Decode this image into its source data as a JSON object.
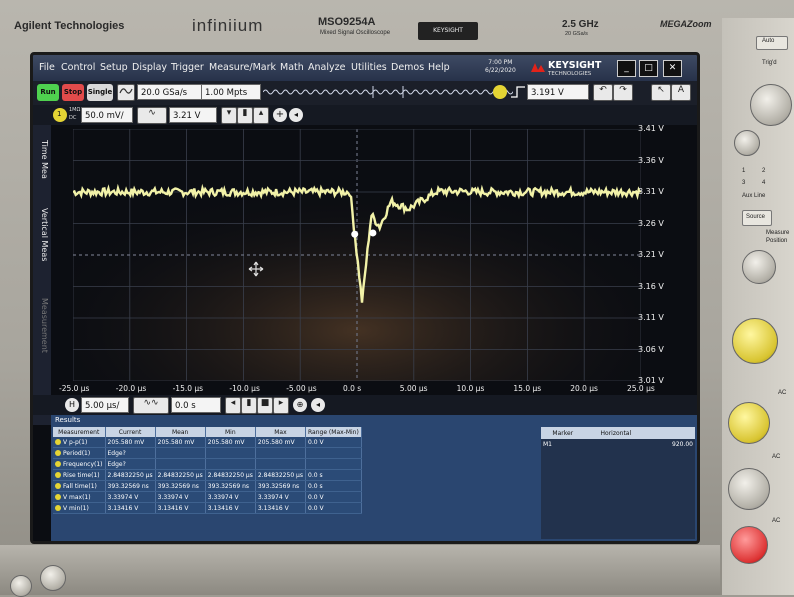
{
  "instrument": {
    "brand": "Agilent Technologies",
    "series": "infiniium",
    "model": "MSO9254A",
    "model_sub": "Mixed Signal Oscilloscope",
    "bandwidth": "2.5 GHz",
    "sample_rate_spec": "20 GSa/s",
    "mega": "MEGAZoom",
    "badge": "KEYSIGHT",
    "panel": {
      "auto": "Auto",
      "trig": "Trig'd",
      "aux": "Aux Line",
      "source": "Source",
      "measure": "Measure",
      "position": "Position",
      "ac_label": "AC",
      "ch_nums": [
        "1",
        "2",
        "3",
        "4"
      ]
    }
  },
  "menu": [
    "File",
    "Control",
    "Setup",
    "Display",
    "Trigger",
    "Measure/Mark",
    "Math",
    "Analyze",
    "Utilities",
    "Demos",
    "Help"
  ],
  "datetime": {
    "time": "7:00 PM",
    "date": "6/22/2020"
  },
  "logo": {
    "name": "KEYSIGHT",
    "sub": "TECHNOLOGIES"
  },
  "window_buttons": {
    "min": "_",
    "max": "□",
    "close": "✕"
  },
  "toolbar": {
    "run": "Run",
    "stop": "Stop",
    "single": "Single",
    "sample_rate": "20.0 GSa/s",
    "memory": "1.00 Mpts",
    "trigger_level": "3.191 V",
    "colors": {
      "run": "#4fd14f",
      "stop": "#e24b4b",
      "single": "#d9d9d9"
    }
  },
  "channel": {
    "coupling_top": "1MΩ",
    "coupling_bottom": "DC",
    "scale": "50.0 mV/",
    "offset": "3.21 V",
    "channel_number": "1"
  },
  "left_tabs": [
    "Time Mea",
    "Vertical Meas",
    "Measurement"
  ],
  "graticule": {
    "y_labels": [
      "3.41 V",
      "3.36 V",
      "3.31 V",
      "3.26 V",
      "3.21 V",
      "3.16 V",
      "3.11 V",
      "3.06 V",
      "3.01 V"
    ],
    "x_labels": [
      "-25.0 µs",
      "-20.0 µs",
      "-15.0 µs",
      "-10.0 µs",
      "-5.00 µs",
      "0.0 s",
      "5.00 µs",
      "10.0 µs",
      "15.0 µs",
      "20.0 µs",
      "25.0 µs"
    ],
    "trace_color": "#f2f2a8"
  },
  "timebase": {
    "scale": "5.00 µs/",
    "position": "0.0 s"
  },
  "results": {
    "title": "Results",
    "columns": [
      "Measurement",
      "Current",
      "Mean",
      "Min",
      "Max",
      "Range (Max-Min)"
    ],
    "rows": [
      [
        "V p-p(1)",
        "205.580 mV",
        "205.580 mV",
        "205.580 mV",
        "205.580 mV",
        "0.0 V"
      ],
      [
        "Period(1)",
        "Edge?",
        "",
        "",
        "",
        ""
      ],
      [
        "Frequency(1)",
        "Edge?",
        "",
        "",
        "",
        ""
      ],
      [
        "Rise time(1)",
        "2.84832250 µs",
        "2.84832250 µs",
        "2.84832250 µs",
        "2.84832250 µs",
        "0.0 s"
      ],
      [
        "Fall time(1)",
        "393.32569 ns",
        "393.32569 ns",
        "393.32569 ns",
        "393.32569 ns",
        "0.0 s"
      ],
      [
        "V max(1)",
        "3.33974 V",
        "3.33974 V",
        "3.33974 V",
        "3.33974 V",
        "0.0 V"
      ],
      [
        "V min(1)",
        "3.13416 V",
        "3.13416 V",
        "3.13416 V",
        "3.13416 V",
        "0.0 V"
      ]
    ],
    "marker_columns": [
      "Marker",
      "Horizontal"
    ],
    "marker_rows": [
      [
        "M1",
        "",
        "920.00"
      ]
    ]
  }
}
